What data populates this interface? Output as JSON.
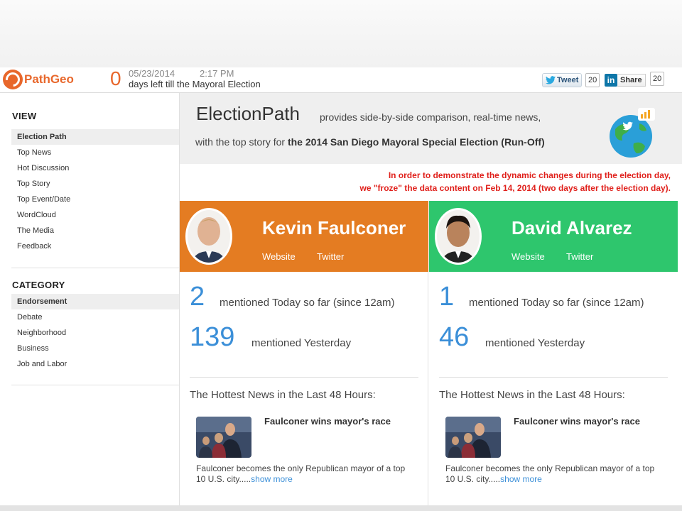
{
  "header": {
    "logo_text": "PathGeo",
    "countdown_number": "0",
    "date": "05/23/2014",
    "time": "2:17 PM",
    "countdown_text": "days left till the Mayoral Election",
    "tweet_label": "Tweet",
    "tweet_count": "20",
    "share_label": "Share",
    "share_count": "20"
  },
  "sidebar": {
    "view_heading": "VIEW",
    "view_items": [
      "Election Path",
      "Top News",
      "Hot Discussion",
      "Top Story",
      "Top Event/Date",
      "WordCloud",
      "The Media",
      "Feedback"
    ],
    "category_heading": "CATEGORY",
    "category_items": [
      "Endorsement",
      "Debate",
      "Neighborhood",
      "Business",
      "Job and Labor"
    ]
  },
  "banner": {
    "title": "ElectionPath",
    "line1": " provides side-by-side comparison, real-time news,",
    "line2_prefix": "with the top story for ",
    "line2_bold": "the 2014 San Diego Mayoral Special Election (Run-Off)"
  },
  "notice": {
    "line1": "In order to demonstrate the dynamic changes during the election day,",
    "line2": "we \"froze\" the data content on Feb 14, 2014 (two days after the election day)."
  },
  "candidates": [
    {
      "name": "Kevin Faulconer",
      "website_label": "Website",
      "twitter_label": "Twitter",
      "today_count": "2",
      "today_label": "mentioned Today so far (since 12am)",
      "yesterday_count": "139",
      "yesterday_label": "mentioned Yesterday",
      "hot_title": "The Hottest News in the Last 48 Hours:",
      "news_title": "Faulconer wins mayor's race",
      "news_summary": "Faulconer becomes the only Republican mayor of a top 10 U.S. city.....",
      "show_more": "show more",
      "color": "#e47c22"
    },
    {
      "name": "David Alvarez",
      "website_label": "Website",
      "twitter_label": "Twitter",
      "today_count": "1",
      "today_label": "mentioned Today so far (since 12am)",
      "yesterday_count": "46",
      "yesterday_label": "mentioned Yesterday",
      "hot_title": "The Hottest News in the Last 48 Hours:",
      "news_title": "Faulconer wins mayor's race",
      "news_summary": "Faulconer becomes the only Republican mayor of a top 10 U.S. city.....",
      "show_more": "show more",
      "color": "#2ec66d"
    }
  ],
  "colors": {
    "accent": "#e8672b",
    "link_blue": "#3b8fd8",
    "notice_red": "#e0201b"
  }
}
